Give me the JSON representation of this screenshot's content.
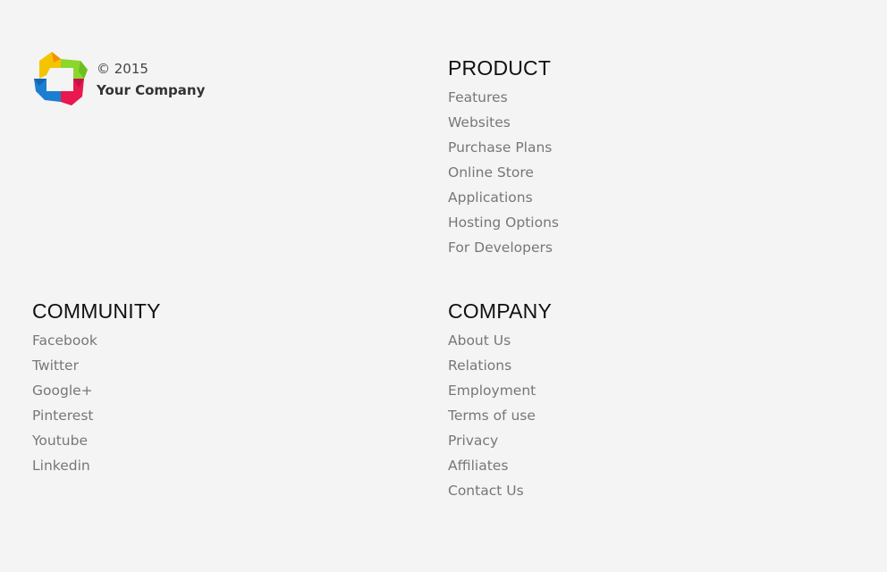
{
  "brand": {
    "copyright": "© 2015",
    "company_name": "Your Company",
    "logo_icon": "colorful-square-logo-icon"
  },
  "colors": {
    "background": "#f4f4f4",
    "heading": "#111111",
    "link": "#777777",
    "logo_yellow": "#f5c400",
    "logo_green": "#8cd62d",
    "logo_pink": "#e8194f",
    "logo_blue": "#1a7fd0"
  },
  "sections": {
    "product": {
      "title": "PRODUCT",
      "links": [
        "Features",
        "Websites",
        "Purchase Plans",
        "Online Store",
        "Applications",
        "Hosting Options",
        "For Developers"
      ]
    },
    "community": {
      "title": "COMMUNITY",
      "links": [
        "Facebook",
        "Twitter",
        "Google+",
        "Pinterest",
        "Youtube",
        "Linkedin"
      ]
    },
    "company": {
      "title": "COMPANY",
      "links": [
        "About Us",
        "Relations",
        "Employment",
        "Terms of use",
        "Privacy",
        "Affiliates",
        "Contact Us"
      ]
    }
  }
}
